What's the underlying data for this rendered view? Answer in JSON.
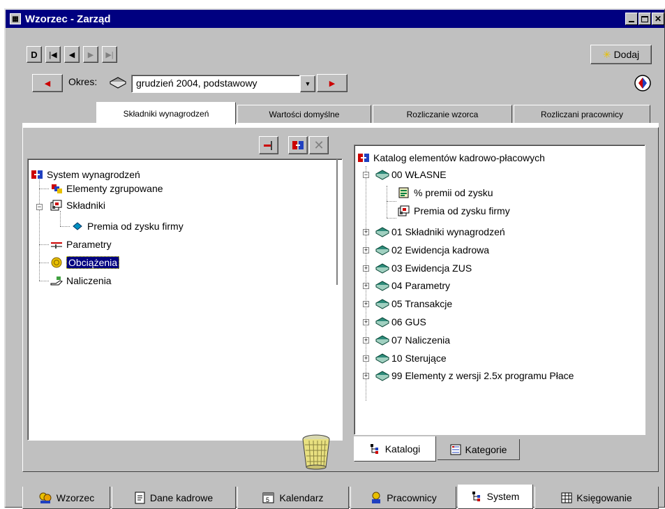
{
  "window": {
    "title": "Wzorzec - Zarząd"
  },
  "toolbar": {
    "add_label": "Dodaj"
  },
  "period": {
    "label": "Okres:",
    "value": "grudzień 2004, podstawowy"
  },
  "top_tabs": [
    {
      "label": "Składniki wynagrodzeń",
      "active": true
    },
    {
      "label": "Wartości domyślne",
      "active": false
    },
    {
      "label": "Rozliczanie wzorca",
      "active": false
    },
    {
      "label": "Rozliczani pracownicy",
      "active": false
    }
  ],
  "left_tree": {
    "root": "System wynagrodzeń",
    "items": [
      {
        "label": "Elementy zgrupowane",
        "icon": "grouped-elements-icon"
      },
      {
        "label": "Składniki",
        "icon": "components-icon"
      },
      {
        "label": "Premia od zysku firmy",
        "icon": "diamond-icon"
      },
      {
        "label": "Parametry",
        "icon": "parameters-icon"
      },
      {
        "label": "Obciążenia",
        "icon": "charges-icon",
        "selected": true
      },
      {
        "label": "Naliczenia",
        "icon": "accruals-icon"
      }
    ]
  },
  "right_tree": {
    "root": "Katalog elementów kadrowo-płacowych",
    "own": "00 WŁASNE",
    "own_children": [
      "% premii od zysku",
      "Premia od zysku firmy"
    ],
    "catalogs": [
      "01 Składniki wynagrodzeń",
      "02 Ewidencja kadrowa",
      "03 Ewidencja ZUS",
      "04 Parametry",
      "05 Transakcje",
      "06 GUS",
      "07 Naliczenia",
      "10 Sterujące",
      "99 Elementy z wersji 2.5x programu Płace"
    ]
  },
  "right_tabs": [
    {
      "label": "Katalogi",
      "active": true
    },
    {
      "label": "Kategorie",
      "active": false
    }
  ],
  "bottom_tabs": [
    {
      "label": "Wzorzec",
      "active": false
    },
    {
      "label": "Dane kadrowe",
      "active": false
    },
    {
      "label": "Kalendarz",
      "active": false
    },
    {
      "label": "Pracownicy",
      "active": false
    },
    {
      "label": "System",
      "active": true
    },
    {
      "label": "Księgowanie",
      "active": false
    }
  ],
  "colors": {
    "titlebar": "#000080",
    "face": "#c0c0c0",
    "book": "#2e8b7a",
    "nav_arrow": "#cc0000"
  }
}
